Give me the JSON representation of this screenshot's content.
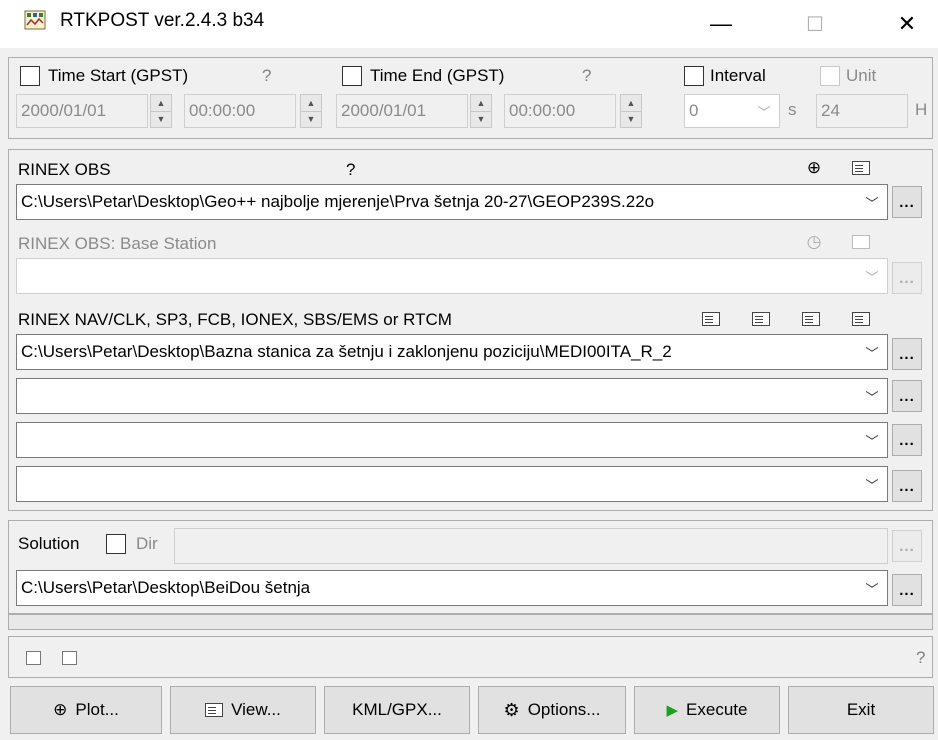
{
  "window": {
    "title": "RTKPOST ver.2.4.3 b34",
    "minimize": "—",
    "maximize": "☐",
    "close": "✕"
  },
  "time": {
    "start_label": "Time Start (GPST)",
    "end_label": "Time End (GPST)",
    "question": "?",
    "start_date": "2000/01/01",
    "start_time": "00:00:00",
    "end_date": "2000/01/01",
    "end_time": "00:00:00",
    "interval_label": "Interval",
    "interval_value": "0",
    "interval_unit": "s",
    "unit_label": "Unit",
    "unit_value": "24",
    "unit_suffix": "H"
  },
  "inputs": {
    "rinex_obs_label": "RINEX OBS",
    "rinex_obs_q": "?",
    "rinex_obs_path": "C:\\Users\\Petar\\Desktop\\Geo++ najbolje mjerenje\\Prva šetnja 20-27\\GEOP239S.22o",
    "base_label": "RINEX OBS: Base Station",
    "base_path": "",
    "nav_label": "RINEX NAV/CLK, SP3, FCB, IONEX, SBS/EMS  or RTCM",
    "nav_path_1": "C:\\Users\\Petar\\Desktop\\Bazna stanica za šetnju i zaklonjenu poziciju\\MEDI00ITA_R_2",
    "nav_path_2": "",
    "nav_path_3": "",
    "nav_path_4": "",
    "browse": "..."
  },
  "solution": {
    "label": "Solution",
    "dir_label": "Dir",
    "dir_value": "",
    "path": "C:\\Users\\Petar\\Desktop\\BeiDou šetnja"
  },
  "status": {
    "question": "?"
  },
  "buttons": {
    "plot": "Plot...",
    "view": "View...",
    "kml": "KML/GPX...",
    "options": "Options...",
    "execute": "Execute",
    "exit": "Exit"
  },
  "colors": {
    "execute_icon": "#1aa31a",
    "window_bg": "#f0f0f0"
  }
}
